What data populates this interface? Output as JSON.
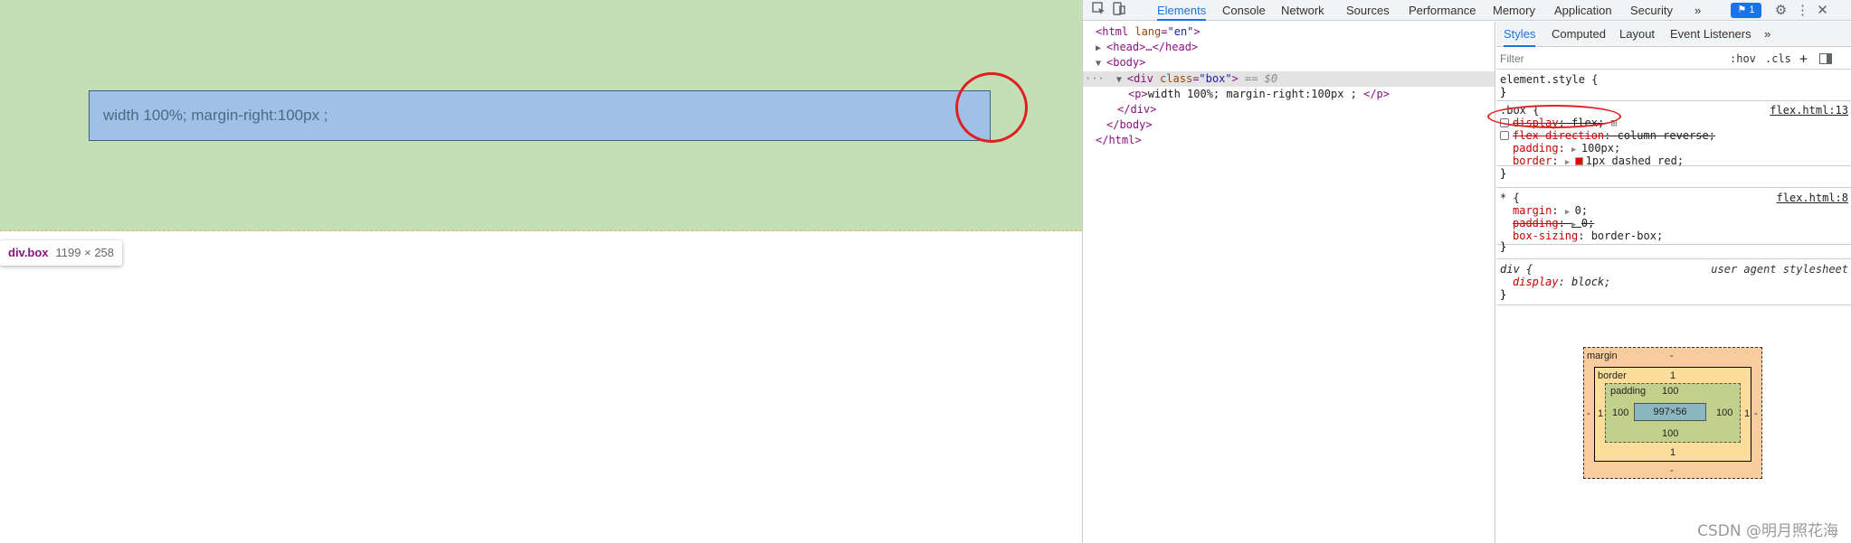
{
  "viewport": {
    "paragraph_text": "width 100%; margin-right:100px ;",
    "tooltip": {
      "name": "div.box",
      "size": "1199 × 258"
    }
  },
  "devtools": {
    "tabs": [
      "Elements",
      "Console",
      "Network",
      "Sources",
      "Performance",
      "Memory",
      "Application",
      "Security"
    ],
    "more_tabs": "»",
    "issues_count": "1",
    "dom": {
      "html_open": "<html",
      "lang_attr": "lang",
      "lang_val": "\"en\"",
      "gt": ">",
      "head": "<head>…</head>",
      "body_open": "<body>",
      "div_open_tag": "<div",
      "class_attr": "class",
      "class_val": "\"box\"",
      "div_gt": ">",
      "eq": " == $0",
      "p_open": "<p>",
      "p_text": "width 100%; margin-right:100px ; ",
      "p_close": "</p>",
      "div_close": "</div>",
      "body_close": "</body>",
      "html_close": "</html>",
      "ellipsis": "···"
    },
    "subtabs": [
      "Styles",
      "Computed",
      "Layout",
      "Event Listeners"
    ],
    "subtabs_more": "»",
    "filter_placeholder": "Filter",
    "hov": ":hov",
    "cls": ".cls",
    "rules": {
      "element_style": "element.style {",
      "close": "}",
      "box_selector": ".box {",
      "box_source": "flex.html:13",
      "box_props": [
        {
          "name": "display",
          "value": "flex",
          "icon": "⊞",
          "disabled": true
        },
        {
          "name": "flex-direction",
          "value": "column-reverse",
          "disabled": true
        },
        {
          "name": "padding",
          "value": "100px",
          "disabled": false
        },
        {
          "name": "border",
          "value": "1px dashed red",
          "disabled": false
        }
      ],
      "star_selector": "* {",
      "star_source": "flex.html:8",
      "star_props": [
        {
          "name": "margin",
          "value": "0",
          "struck": false
        },
        {
          "name": "padding",
          "value": "0",
          "struck": true
        },
        {
          "name": "box-sizing",
          "value": "border-box",
          "struck": false
        }
      ],
      "div_selector": "div {",
      "div_source": "user agent stylesheet",
      "div_prop": {
        "name": "display",
        "value": "block"
      }
    },
    "box_model": {
      "margin_label": "margin",
      "margin_top": "-",
      "margin_bottom": "-",
      "margin_left": "-",
      "margin_right": "-",
      "border_label": "border",
      "border_top": "1",
      "border_bottom": "1",
      "border_left": "1",
      "border_right": "1",
      "padding_label": "padding",
      "padding_top": "100",
      "padding_bottom": "100",
      "padding_left": "100",
      "padding_right": "100",
      "content": "997×56"
    }
  },
  "watermark": "CSDN @明月照花海",
  "colors": {
    "body_highlight": "#c4deb5",
    "p_highlight": "#9fc1e6",
    "accent": "#1a73e8",
    "annotation": "#e02020"
  }
}
